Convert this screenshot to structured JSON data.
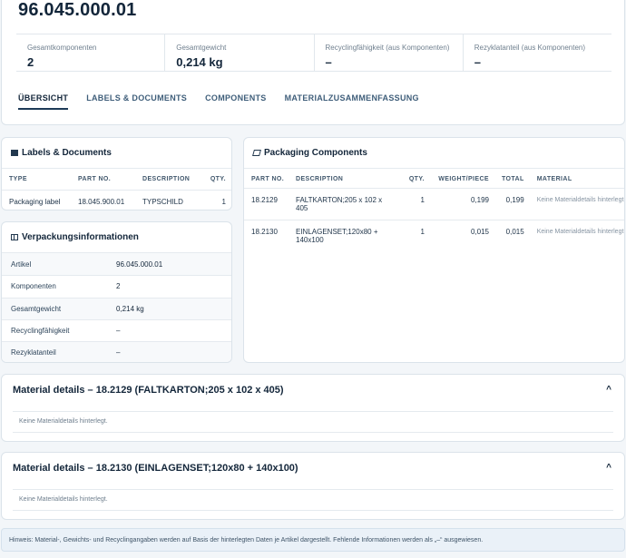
{
  "header": {
    "title": "96.045.000.01",
    "stats": [
      {
        "label": "Gesamtkomponenten",
        "value": "2"
      },
      {
        "label": "Gesamtgewicht",
        "value": "0,214 kg"
      },
      {
        "label": "Recyclingfähigkeit (aus Komponenten)",
        "value": "–"
      },
      {
        "label": "Rezyklatanteil (aus Komponenten)",
        "value": "–"
      }
    ],
    "tabs": [
      "ÜBERSICHT",
      "LABELS & DOCUMENTS",
      "COMPONENTS",
      "MATERIALZUSAMMENFASSUNG"
    ]
  },
  "labels_docs": {
    "title": "Labels & Documents",
    "columns": [
      "TYPE",
      "PART NO.",
      "DESCRIPTION",
      "QTY."
    ],
    "rows": [
      {
        "type": "Packaging label",
        "part_no": "18.045.900.01",
        "description": "TYPSCHILD",
        "qty": "1"
      }
    ]
  },
  "packaging_info": {
    "title": "Verpackungsinformationen",
    "rows": [
      {
        "key": "Artikel",
        "value": "96.045.000.01"
      },
      {
        "key": "Komponenten",
        "value": "2"
      },
      {
        "key": "Gesamtgewicht",
        "value": "0,214 kg"
      },
      {
        "key": "Recyclingfähigkeit",
        "value": "–"
      },
      {
        "key": "Rezyklatanteil",
        "value": "–"
      }
    ]
  },
  "packaging_components": {
    "title": "Packaging Components",
    "columns": [
      "PART NO.",
      "DESCRIPTION",
      "QTY.",
      "WEIGHT/PIECE",
      "TOTAL",
      "MATERIAL"
    ],
    "rows": [
      {
        "part_no": "18.2129",
        "description": "FALTKARTON;205 x 102 x 405",
        "qty": "1",
        "weight": "0,199",
        "total": "0,199",
        "material": "Keine Materialdetails hinterlegt"
      },
      {
        "part_no": "18.2130",
        "description": "EINLAGENSET;120x80 + 140x100",
        "qty": "1",
        "weight": "0,015",
        "total": "0,015",
        "material": "Keine Materialdetails hinterlegt"
      }
    ]
  },
  "material_details": [
    {
      "title": "Material details – 18.2129 (FALTKARTON;205 x 102 x 405)",
      "body": "Keine Materialdetails hinterlegt.",
      "chevron": "^"
    },
    {
      "title": "Material details – 18.2130 (EINLAGENSET;120x80 + 140x100)",
      "body": "Keine Materialdetails hinterlegt.",
      "chevron": "^"
    }
  ],
  "hint": "Hinweis: Material-, Gewichts- und Recyclingangaben werden auf Basis der hinterlegten Daten je Artikel dargestellt. Fehlende Informationen werden als „–“ ausgewiesen."
}
